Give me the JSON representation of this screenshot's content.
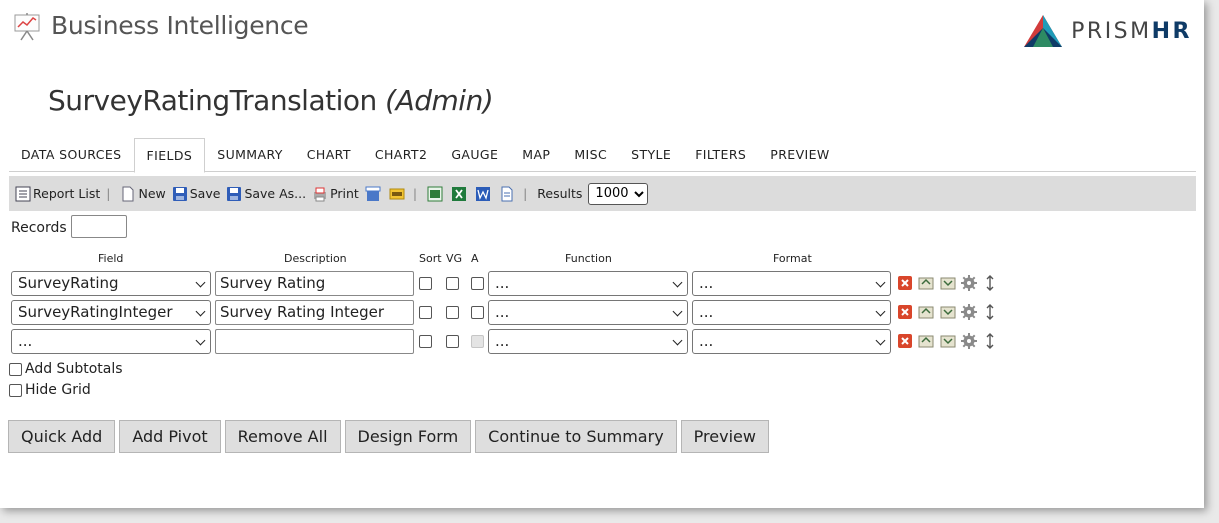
{
  "app": {
    "title": "Business Intelligence",
    "brand_prefix": "PRISM",
    "brand_suffix": "HR"
  },
  "page": {
    "title": "SurveyRatingTranslation",
    "role": "(Admin)"
  },
  "tabs": [
    {
      "label": "DATA SOURCES"
    },
    {
      "label": "FIELDS"
    },
    {
      "label": "SUMMARY"
    },
    {
      "label": "CHART"
    },
    {
      "label": "CHART2"
    },
    {
      "label": "GAUGE"
    },
    {
      "label": "MAP"
    },
    {
      "label": "MISC"
    },
    {
      "label": "STYLE"
    },
    {
      "label": "FILTERS"
    },
    {
      "label": "PREVIEW"
    }
  ],
  "active_tab": "FIELDS",
  "toolbar": {
    "report_list": "Report List",
    "new": "New",
    "save": "Save",
    "save_as": "Save As...",
    "print": "Print",
    "results_label": "Results",
    "results_value": "1000"
  },
  "records_label": "Records",
  "columns": {
    "field": "Field",
    "description": "Description",
    "sort": "Sort",
    "vg": "VG",
    "a": "A",
    "function": "Function",
    "format": "Format"
  },
  "rows": [
    {
      "field": "SurveyRating",
      "description": "Survey Rating",
      "function": "...",
      "format": "..."
    },
    {
      "field": "SurveyRatingInteger",
      "description": "Survey Rating Integer",
      "function": "...",
      "format": "..."
    },
    {
      "field": "...",
      "description": "",
      "function": "...",
      "format": "..."
    }
  ],
  "options": {
    "add_subtotals": "Add Subtotals",
    "hide_grid": "Hide Grid"
  },
  "buttons": {
    "quick_add": "Quick Add",
    "add_pivot": "Add Pivot",
    "remove_all": "Remove All",
    "design_form": "Design Form",
    "continue_summary": "Continue to Summary",
    "preview": "Preview"
  },
  "colors": {
    "brand_navy": "#0f3b67",
    "toolbar_bg": "#dcdcdc",
    "delete_red": "#d9462b"
  }
}
